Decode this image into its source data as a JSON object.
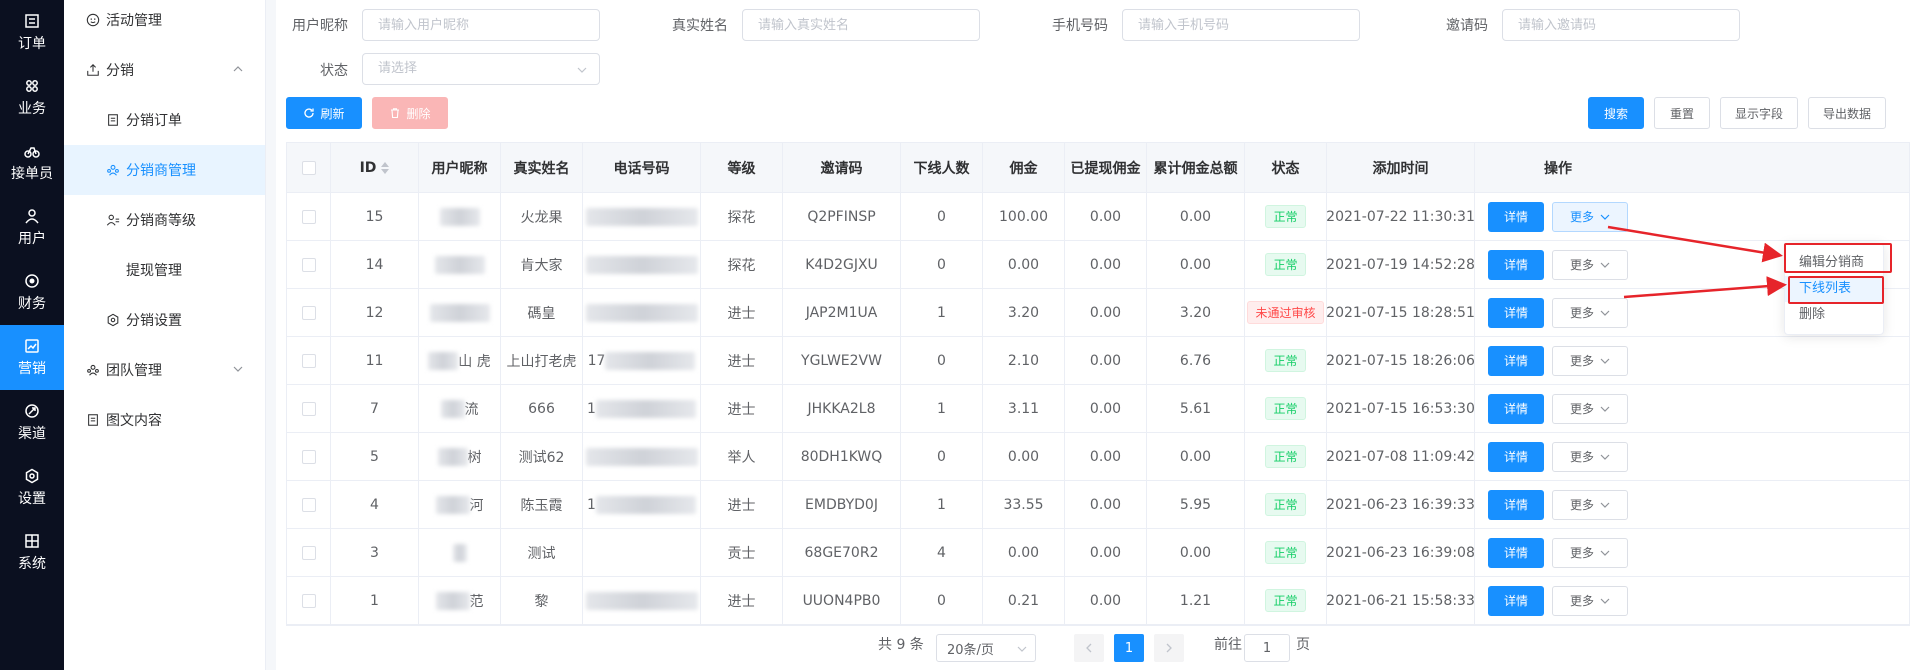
{
  "rail": [
    {
      "label": "订单",
      "icon": "order-icon"
    },
    {
      "label": "业务",
      "icon": "business-icon"
    },
    {
      "label": "接单员",
      "icon": "bike-icon"
    },
    {
      "label": "用户",
      "icon": "user-icon"
    },
    {
      "label": "财务",
      "icon": "finance-icon"
    },
    {
      "label": "营销",
      "icon": "marketing-icon",
      "active": true
    },
    {
      "label": "渠道",
      "icon": "channel-icon"
    },
    {
      "label": "设置",
      "icon": "settings-icon"
    },
    {
      "label": "系统",
      "icon": "system-icon"
    }
  ],
  "sidebar": {
    "items": [
      {
        "label": "活动管理"
      },
      {
        "label": "分销"
      },
      {
        "label": "分销订单"
      },
      {
        "label": "分销商管理"
      },
      {
        "label": "分销商等级"
      },
      {
        "label": "提现管理"
      },
      {
        "label": "分销设置"
      },
      {
        "label": "团队管理"
      },
      {
        "label": "图文内容"
      }
    ]
  },
  "filters": {
    "nickname": {
      "label": "用户昵称",
      "placeholder": "请输入用户昵称"
    },
    "realname": {
      "label": "真实姓名",
      "placeholder": "请输入真实姓名"
    },
    "phone": {
      "label": "手机号码",
      "placeholder": "请输入手机号码"
    },
    "invite": {
      "label": "邀请码",
      "placeholder": "请输入邀请码"
    },
    "status": {
      "label": "状态",
      "placeholder": "请选择"
    }
  },
  "toolbar": {
    "refresh": "刷新",
    "delete": "删除",
    "search": "搜索",
    "reset": "重置",
    "columns": "显示字段",
    "export": "导出数据"
  },
  "table": {
    "headers": [
      "ID",
      "用户昵称",
      "真实姓名",
      "电话号码",
      "等级",
      "邀请码",
      "下线人数",
      "佣金",
      "已提现佣金",
      "累计佣金总额",
      "状态",
      "添加时间",
      "操作"
    ],
    "rows": [
      {
        "id": "15",
        "realname": "火龙果",
        "level": "探花",
        "code": "Q2PFINSP",
        "downline": "0",
        "commission": "100.00",
        "withdrawn": "0.00",
        "total": "0.00",
        "status": "正常",
        "status_type": "ok",
        "time": "2021-07-22 11:30:31"
      },
      {
        "id": "14",
        "realname": "肯大家",
        "level": "探花",
        "code": "K4D2GJXU",
        "downline": "0",
        "commission": "0.00",
        "withdrawn": "0.00",
        "total": "0.00",
        "status": "正常",
        "status_type": "ok",
        "time": "2021-07-19 14:52:28"
      },
      {
        "id": "12",
        "realname": "碼皇",
        "level": "进士",
        "code": "JAP2M1UA",
        "downline": "1",
        "commission": "3.20",
        "withdrawn": "0.00",
        "total": "3.20",
        "status": "未通过审核",
        "status_type": "bad",
        "time": "2021-07-15 18:28:51"
      },
      {
        "id": "11",
        "nickname_fragment": "山  虎",
        "realname": "上山打老虎",
        "phone_fragment": "17",
        "level": "进士",
        "code": "YGLWE2VW",
        "downline": "0",
        "commission": "2.10",
        "withdrawn": "0.00",
        "total": "6.76",
        "status": "正常",
        "status_type": "ok",
        "time": "2021-07-15 18:26:06"
      },
      {
        "id": "7",
        "nickname_fragment": "流",
        "realname": "666",
        "phone_fragment": "1",
        "level": "进士",
        "code": "JHKKA2L8",
        "downline": "1",
        "commission": "3.11",
        "withdrawn": "0.00",
        "total": "5.61",
        "status": "正常",
        "status_type": "ok",
        "time": "2021-07-15 16:53:30"
      },
      {
        "id": "5",
        "nickname_fragment": "树",
        "realname": "测试62",
        "level": "举人",
        "code": "80DH1KWQ",
        "downline": "0",
        "commission": "0.00",
        "withdrawn": "0.00",
        "total": "0.00",
        "status": "正常",
        "status_type": "ok",
        "time": "2021-07-08 11:09:42"
      },
      {
        "id": "4",
        "nickname_fragment": "河",
        "realname": "陈玉霞",
        "phone_fragment": "1",
        "level": "进士",
        "code": "EMDBYD0J",
        "downline": "1",
        "commission": "33.55",
        "withdrawn": "0.00",
        "total": "5.95",
        "status": "正常",
        "status_type": "ok",
        "time": "2021-06-23 16:39:33"
      },
      {
        "id": "3",
        "realname": "测试",
        "level": "贡士",
        "code": "68GE70R2",
        "downline": "4",
        "commission": "0.00",
        "withdrawn": "0.00",
        "total": "0.00",
        "status": "正常",
        "status_type": "ok",
        "time": "2021-06-23 16:39:08"
      },
      {
        "id": "1",
        "nickname_fragment": "范",
        "realname": "黎",
        "level": "进士",
        "code": "UUON4PB0",
        "downline": "0",
        "commission": "0.21",
        "withdrawn": "0.00",
        "total": "1.21",
        "status": "正常",
        "status_type": "ok",
        "time": "2021-06-21 15:58:33"
      }
    ],
    "detail_label": "详情",
    "more_label": "更多"
  },
  "dropdown": {
    "items": [
      "编辑分销商",
      "下线列表",
      "删除"
    ]
  },
  "pagination": {
    "total": "共 9 条",
    "page_size": "20条/页",
    "current": "1",
    "goto_prefix": "前往",
    "goto_value": "1",
    "goto_suffix": "页"
  },
  "colors": {
    "primary": "#1890ff",
    "rail_bg": "#0b1020",
    "ok": "#13ce66",
    "bad": "#ff4949",
    "annotation": "#e6242a"
  }
}
